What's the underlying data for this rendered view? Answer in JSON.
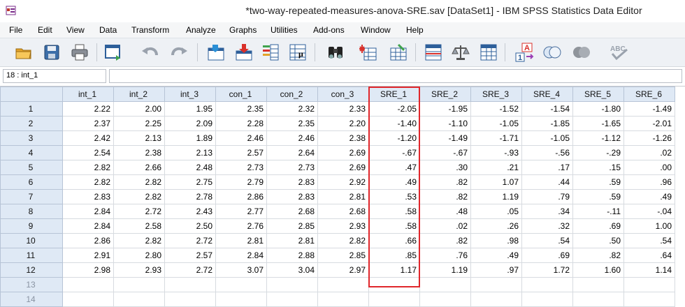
{
  "window": {
    "title": "*two-way-repeated-measures-anova-SRE.sav [DataSet1] - IBM SPSS Statistics Data Editor"
  },
  "menu": [
    "File",
    "Edit",
    "View",
    "Data",
    "Transform",
    "Analyze",
    "Graphs",
    "Utilities",
    "Add-ons",
    "Window",
    "Help"
  ],
  "toolbar": {
    "icons": [
      "open-folder-icon",
      "save-icon",
      "print-icon",
      "dialog-recall-icon",
      "undo-icon",
      "redo-icon",
      "goto-case-icon",
      "goto-variable-icon",
      "variables-icon",
      "run-descriptives-icon",
      "find-icon",
      "insert-cases-icon",
      "insert-variable-icon",
      "split-file-icon",
      "weight-cases-icon",
      "select-cases-icon",
      "value-labels-icon",
      "use-sets-icon",
      "show-all-variables-icon",
      "spell-check-icon"
    ]
  },
  "cell_editor": {
    "reference": "18 : int_1",
    "value": ""
  },
  "grid": {
    "columns": [
      "int_1",
      "int_2",
      "int_3",
      "con_1",
      "con_2",
      "con_3",
      "SRE_1",
      "SRE_2",
      "SRE_3",
      "SRE_4",
      "SRE_5",
      "SRE_6"
    ],
    "highlighted_column": "SRE_1",
    "rows": [
      {
        "n": "1",
        "cells": [
          "2.22",
          "2.00",
          "1.95",
          "2.35",
          "2.32",
          "2.33",
          "-2.05",
          "-1.95",
          "-1.52",
          "-1.54",
          "-1.80",
          "-1.49"
        ]
      },
      {
        "n": "2",
        "cells": [
          "2.37",
          "2.25",
          "2.09",
          "2.28",
          "2.35",
          "2.20",
          "-1.40",
          "-1.10",
          "-1.05",
          "-1.85",
          "-1.65",
          "-2.01"
        ]
      },
      {
        "n": "3",
        "cells": [
          "2.42",
          "2.13",
          "1.89",
          "2.46",
          "2.46",
          "2.38",
          "-1.20",
          "-1.49",
          "-1.71",
          "-1.05",
          "-1.12",
          "-1.26"
        ]
      },
      {
        "n": "4",
        "cells": [
          "2.54",
          "2.38",
          "2.13",
          "2.57",
          "2.64",
          "2.69",
          "-.67",
          "-.67",
          "-.93",
          "-.56",
          "-.29",
          ".02"
        ]
      },
      {
        "n": "5",
        "cells": [
          "2.82",
          "2.66",
          "2.48",
          "2.73",
          "2.73",
          "2.69",
          ".47",
          ".30",
          ".21",
          ".17",
          ".15",
          ".00"
        ]
      },
      {
        "n": "6",
        "cells": [
          "2.82",
          "2.82",
          "2.75",
          "2.79",
          "2.83",
          "2.92",
          ".49",
          ".82",
          "1.07",
          ".44",
          ".59",
          ".96"
        ]
      },
      {
        "n": "7",
        "cells": [
          "2.83",
          "2.82",
          "2.78",
          "2.86",
          "2.83",
          "2.81",
          ".53",
          ".82",
          "1.19",
          ".79",
          ".59",
          ".49"
        ]
      },
      {
        "n": "8",
        "cells": [
          "2.84",
          "2.72",
          "2.43",
          "2.77",
          "2.68",
          "2.68",
          ".58",
          ".48",
          ".05",
          ".34",
          "-.11",
          "-.04"
        ]
      },
      {
        "n": "9",
        "cells": [
          "2.84",
          "2.58",
          "2.50",
          "2.76",
          "2.85",
          "2.93",
          ".58",
          ".02",
          ".26",
          ".32",
          ".69",
          "1.00"
        ]
      },
      {
        "n": "10",
        "cells": [
          "2.86",
          "2.82",
          "2.72",
          "2.81",
          "2.81",
          "2.82",
          ".66",
          ".82",
          ".98",
          ".54",
          ".50",
          ".54"
        ]
      },
      {
        "n": "11",
        "cells": [
          "2.91",
          "2.80",
          "2.57",
          "2.84",
          "2.88",
          "2.85",
          ".85",
          ".76",
          ".49",
          ".69",
          ".82",
          ".64"
        ]
      },
      {
        "n": "12",
        "cells": [
          "2.98",
          "2.93",
          "2.72",
          "3.07",
          "3.04",
          "2.97",
          "1.17",
          "1.19",
          ".97",
          "1.72",
          "1.60",
          "1.14"
        ]
      },
      {
        "n": "13",
        "cells": [
          "",
          "",
          "",
          "",
          "",
          "",
          "",
          "",
          "",
          "",
          "",
          ""
        ]
      },
      {
        "n": "14",
        "cells": [
          "",
          "",
          "",
          "",
          "",
          "",
          "",
          "",
          "",
          "",
          "",
          ""
        ]
      }
    ]
  },
  "colors": {
    "header_bg": "#dfe9f5",
    "highlight": "#e0262b",
    "toolbar_bg": "#eef1f5"
  }
}
